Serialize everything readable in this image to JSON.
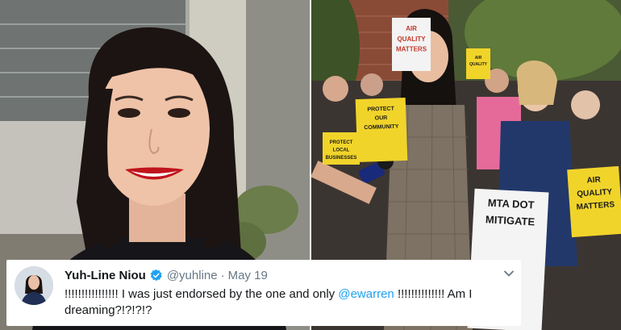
{
  "photos": {
    "left": {
      "icon": "woman-portrait"
    },
    "right": {
      "icon": "rally-crowd",
      "signs": [
        {
          "lines": [
            "AIR",
            "QUALITY",
            "MATTERS"
          ]
        },
        {
          "lines": [
            "PROTECT",
            "OUR",
            "COMMUNITY"
          ]
        },
        {
          "lines": [
            "PROTECT",
            "LOCAL",
            "BUSINESSES"
          ]
        },
        {
          "lines": [
            "AIR",
            "QUALITY",
            "MATTERS"
          ]
        },
        {
          "lines": [
            "MTA DOT",
            "MITIGATE"
          ]
        },
        {
          "lines": [
            "AIR",
            "QUALITY"
          ]
        }
      ]
    }
  },
  "tweet": {
    "display_name": "Yuh-Line Niou",
    "handle": "@yuhline",
    "separator": "·",
    "date": "May 19",
    "text_before": "!!!!!!!!!!!!!!!! I was just endorsed by the one and only ",
    "mention": "@ewarren",
    "text_after": " !!!!!!!!!!!!!! Am I dreaming?!?!?!?",
    "verified_icon": "verified-badge-icon",
    "menu_icon": "chevron-down-icon",
    "colors": {
      "name": "#14171a",
      "muted": "#657786",
      "link": "#1da1f2",
      "verified": "#1da1f2"
    }
  }
}
